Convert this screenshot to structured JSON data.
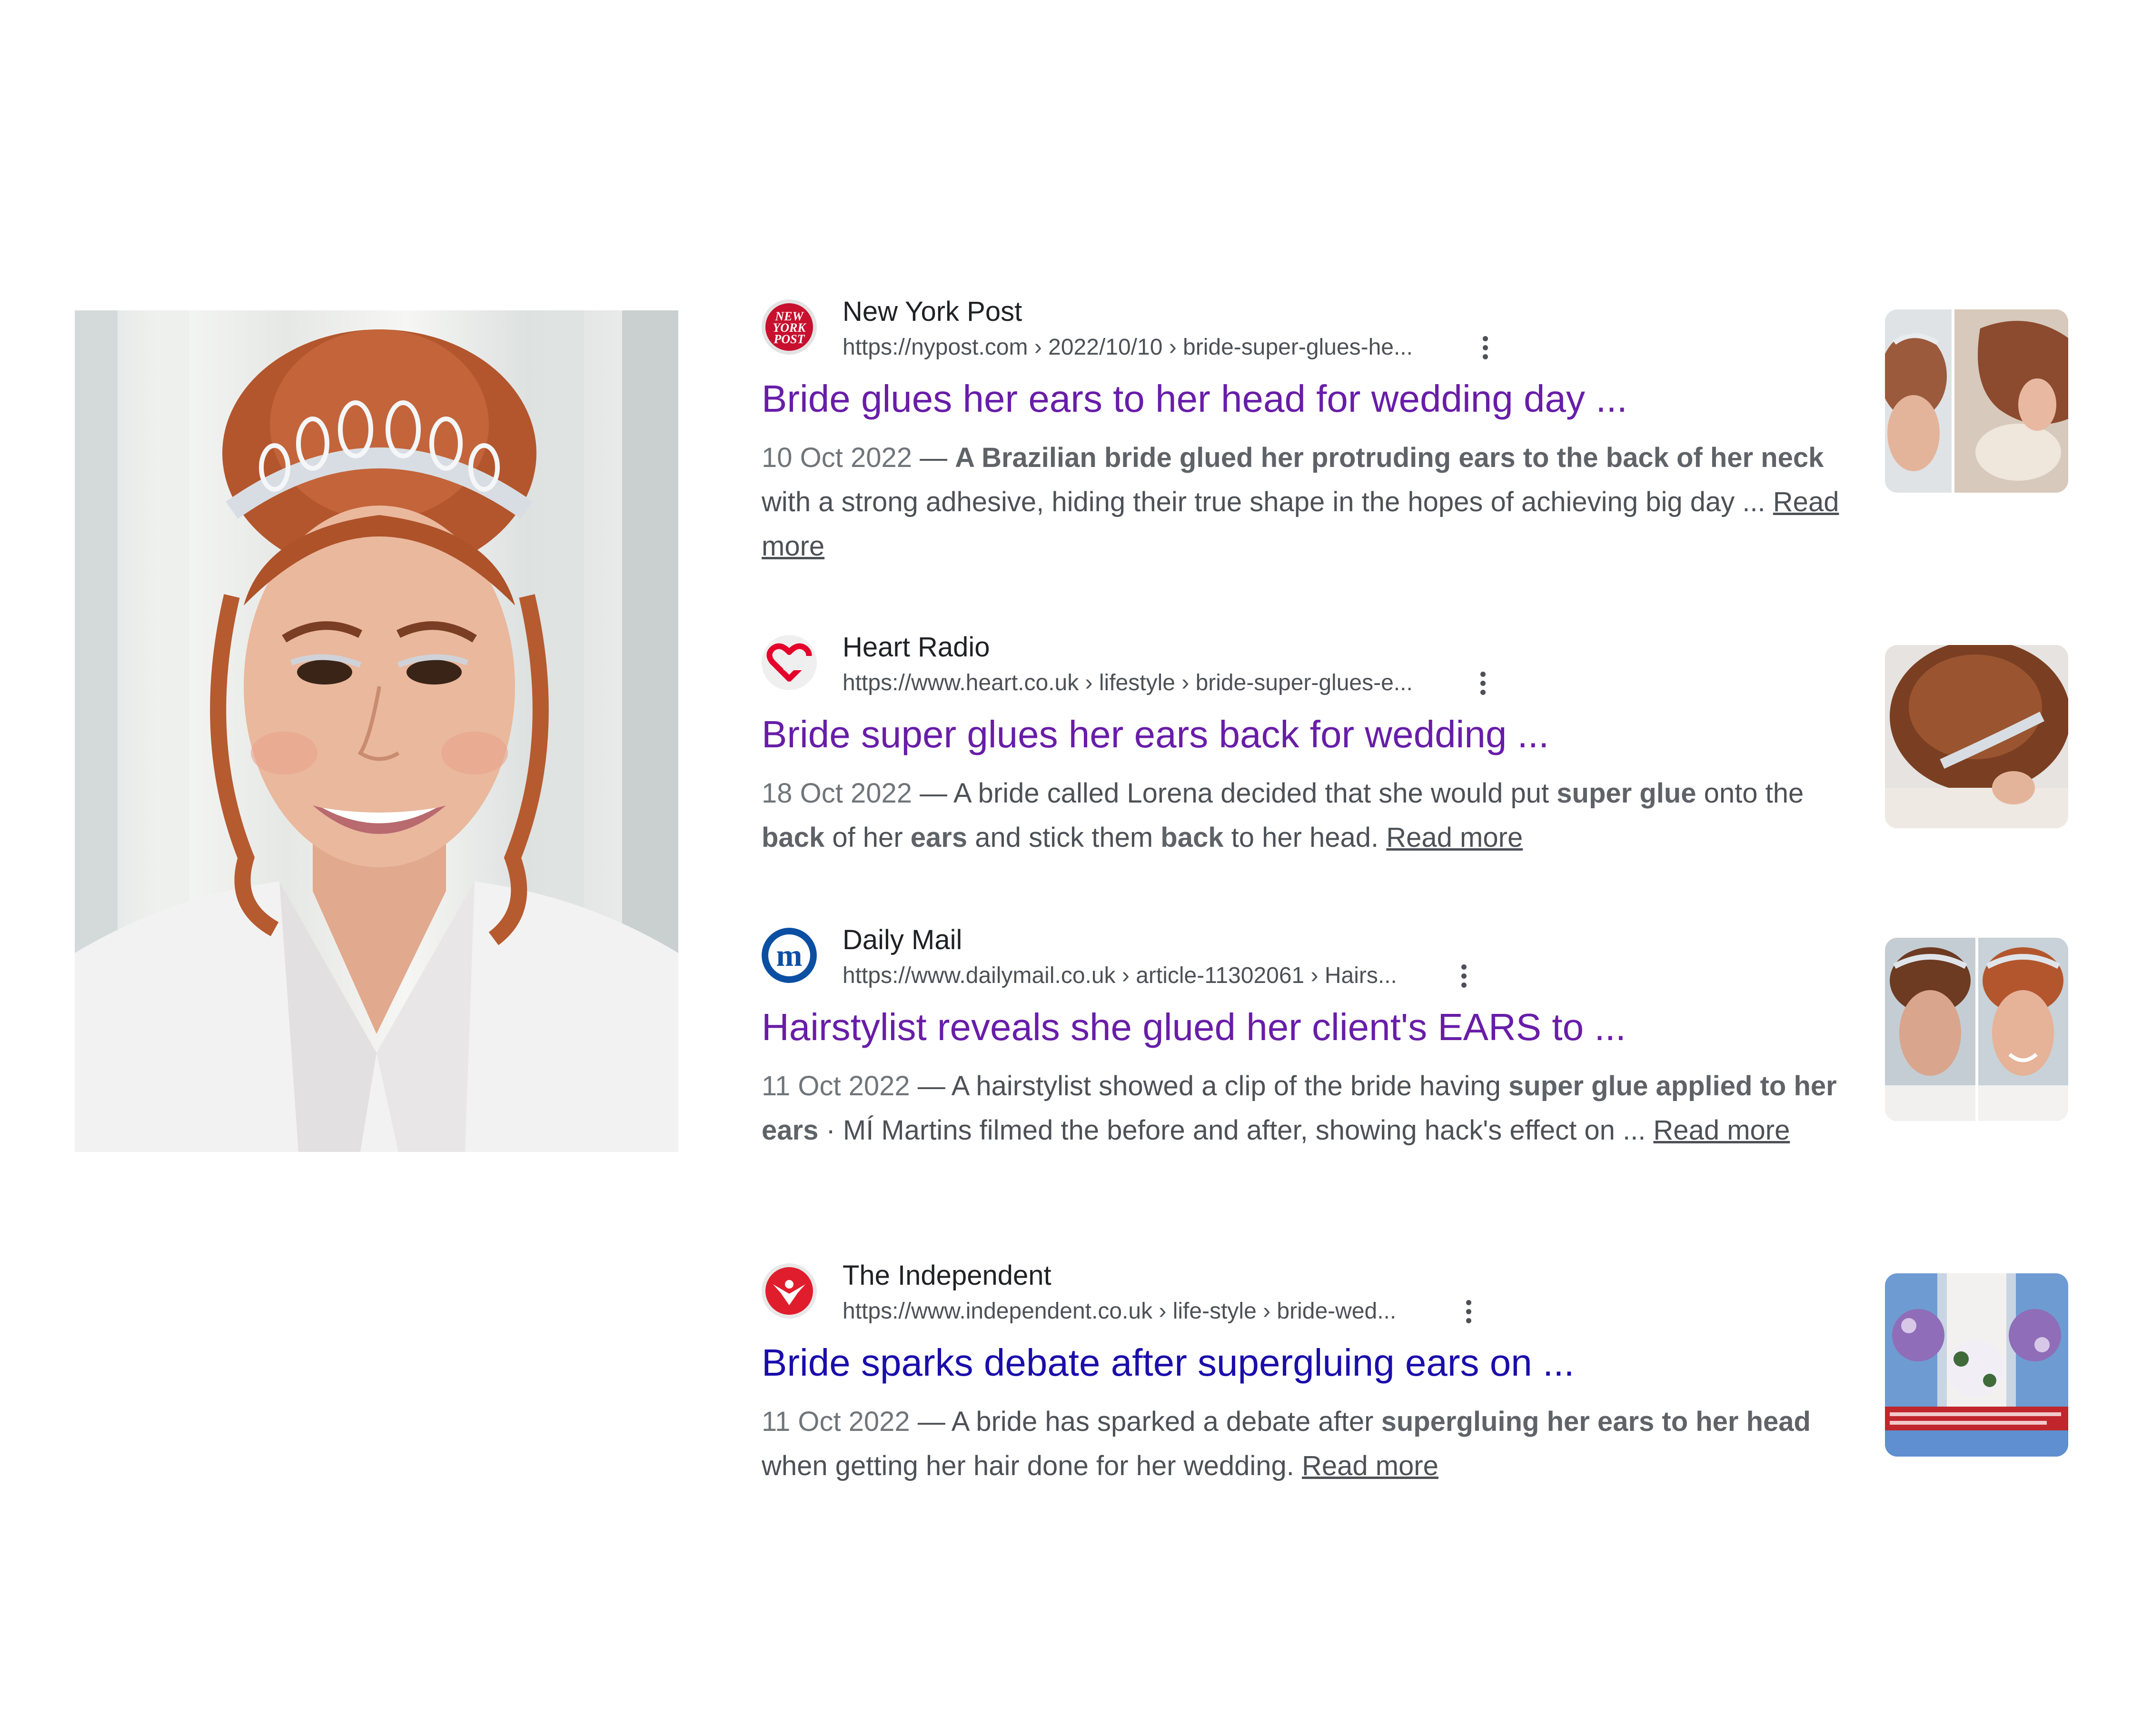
{
  "portrait": {
    "description_icon": "bride-portrait-image"
  },
  "results": [
    {
      "site_name": "New York Post",
      "url": "https://nypost.com › 2022/10/10 › bride-super-glues-he...",
      "title": "Bride glues her ears to her head for wedding day ...",
      "date": "10 Oct 2022",
      "dash": " — ",
      "snippet_parts": [
        {
          "text": "A Brazilian bride glued her protruding ears to the back of her neck",
          "bold": true
        },
        {
          "text": " with a strong adhesive, hiding their true shape in the hopes of achieving big day ... ",
          "bold": false
        }
      ],
      "read_more": "Read more",
      "favicon_icon": "new-york-post-logo-icon",
      "favicon_text": "NEW YORK POST",
      "visited": true
    },
    {
      "site_name": "Heart Radio",
      "url": "https://www.heart.co.uk › lifestyle › bride-super-glues-e...",
      "title": "Bride super glues her ears back for wedding ...",
      "date": "18 Oct 2022",
      "dash": " — ",
      "snippet_parts": [
        {
          "text": "A bride called Lorena decided that she would put ",
          "bold": false
        },
        {
          "text": "super glue",
          "bold": true
        },
        {
          "text": " onto the ",
          "bold": false
        },
        {
          "text": "back",
          "bold": true
        },
        {
          "text": " of her ",
          "bold": false
        },
        {
          "text": "ears",
          "bold": true
        },
        {
          "text": " and stick them ",
          "bold": false
        },
        {
          "text": "back",
          "bold": true
        },
        {
          "text": " to her head. ",
          "bold": false
        }
      ],
      "read_more": "Read more",
      "favicon_icon": "heart-radio-logo-icon",
      "visited": true
    },
    {
      "site_name": "Daily Mail",
      "url": "https://www.dailymail.co.uk › article-11302061 › Hairs...",
      "title": "Hairstylist reveals she glued her client's EARS to ...",
      "date": "11 Oct 2022",
      "dash": " — ",
      "snippet_parts": [
        {
          "text": "A hairstylist showed a clip of the bride having ",
          "bold": false
        },
        {
          "text": "super glue applied to her ears",
          "bold": true
        },
        {
          "text": " · MÍ Martins filmed the before and after, showing hack's effect on ... ",
          "bold": false
        }
      ],
      "read_more": "Read more",
      "favicon_icon": "daily-mail-logo-icon",
      "favicon_text": "m",
      "visited": true
    },
    {
      "site_name": "The Independent",
      "url": "https://www.independent.co.uk › life-style › bride-wed...",
      "title": "Bride sparks debate after supergluing ears on ...",
      "date": "11 Oct 2022",
      "dash": " — ",
      "snippet_parts": [
        {
          "text": "A bride has sparked a debate after ",
          "bold": false
        },
        {
          "text": "supergluing her ears to her head",
          "bold": true
        },
        {
          "text": " when getting her hair done for her wedding. ",
          "bold": false
        }
      ],
      "read_more": "Read more",
      "favicon_icon": "independent-eagle-logo-icon",
      "visited": false
    }
  ],
  "colors": {
    "visited_link": "#681da8",
    "unvisited_link": "#1a0dab",
    "snippet_text": "#4d5156",
    "site_name": "#202124"
  },
  "icons": {
    "more_options": "three-dot-vertical-icon"
  }
}
